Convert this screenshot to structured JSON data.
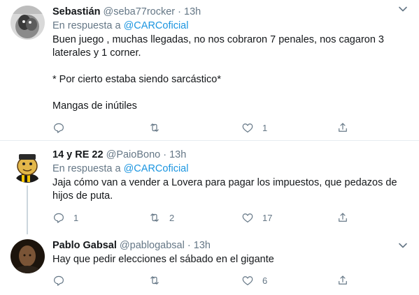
{
  "tweets": [
    {
      "name": "Sebastián",
      "handle": "@seba77rocker",
      "dot": "·",
      "time": "13h",
      "reply_prefix": "En respuesta a",
      "reply_to": "@CARCoficial",
      "text_lines": [
        "Buen juego , muchas llegadas, no nos cobraron 7 penales, nos cagaron 3 laterales y 1 corner.",
        "* Por cierto estaba siendo sarcástico*",
        "Mangas de inútiles"
      ],
      "replies": "",
      "retweets": "",
      "likes": "1"
    },
    {
      "name": "14 y RE 22",
      "handle": "@PaioBono",
      "dot": "·",
      "time": "13h",
      "reply_prefix": "En respuesta a",
      "reply_to": "@CARCoficial",
      "text_lines": [
        "Jaja cómo van a vender a Lovera para pagar los impuestos, que pedazos de hijos de puta."
      ],
      "replies": "1",
      "retweets": "2",
      "likes": "17"
    },
    {
      "name": "Pablo Gabsal",
      "handle": "@pablogabsal",
      "dot": "·",
      "time": "13h",
      "text_lines": [
        "Hay que pedir elecciones el sábado en el gigante"
      ],
      "replies": "",
      "retweets": "",
      "likes": "6"
    }
  ],
  "colors": {
    "text": "#14171a",
    "muted": "#657786",
    "link": "#1b95e0",
    "divider": "#e6ecf0",
    "thread": "#ccd6dd"
  },
  "icons": [
    "reply-icon",
    "retweet-icon",
    "like-icon",
    "share-icon",
    "caret-down-icon"
  ]
}
